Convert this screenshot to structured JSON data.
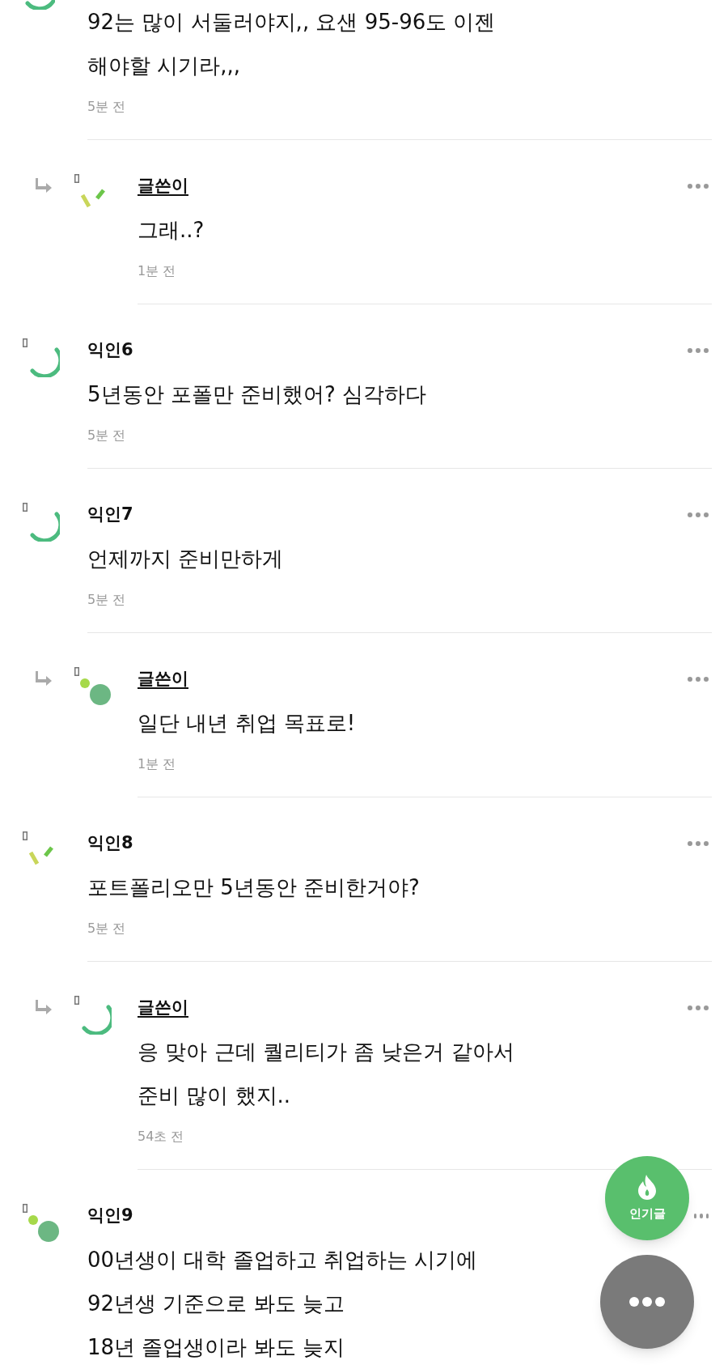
{
  "comments": [
    {
      "reply": false,
      "avatar": {
        "kind": "arc"
      },
      "lines": [
        "92는 많이 서둘러야지,, 요샌 95-96도 이젠",
        "해야할 시기라,,,"
      ],
      "time": "5분 전"
    },
    {
      "reply": true,
      "author": "글쓴이",
      "is_op": true,
      "avatar": {
        "kind": "dashes"
      },
      "lines": [
        "그래..?"
      ],
      "time": "1분 전"
    },
    {
      "reply": false,
      "author": "익인6",
      "is_op": false,
      "avatar": {
        "kind": "arc"
      },
      "lines": [
        "5년동안 포폴만 준비했어? 심각하다"
      ],
      "time": "5분 전"
    },
    {
      "reply": false,
      "author": "익인7",
      "is_op": false,
      "avatar": {
        "kind": "arc"
      },
      "lines": [
        "언제까지 준비만하게"
      ],
      "time": "5분 전"
    },
    {
      "reply": true,
      "author": "글쓴이",
      "is_op": true,
      "avatar": {
        "kind": "dots"
      },
      "lines": [
        "일단 내년 취업 목표로!"
      ],
      "time": "1분 전"
    },
    {
      "reply": false,
      "author": "익인8",
      "is_op": false,
      "avatar": {
        "kind": "dashes"
      },
      "lines": [
        "포트폴리오만 5년동안 준비한거야?"
      ],
      "time": "5분 전"
    },
    {
      "reply": true,
      "author": "글쓴이",
      "is_op": true,
      "avatar": {
        "kind": "arc"
      },
      "lines": [
        "응 맞아 근데 퀄리티가 좀 낮은거 같아서",
        "준비 많이 했지.."
      ],
      "time": "54초 전"
    },
    {
      "reply": false,
      "author": "익인9",
      "is_op": false,
      "avatar": {
        "kind": "dots"
      },
      "lines": [
        "00년생이 대학 졸업하고 취업하는 시기에",
        "92년생 기준으로 봐도 늦고",
        "18년 졸업생이라 봐도 늦지"
      ]
    }
  ],
  "popular_button": {
    "label": "인기글"
  }
}
